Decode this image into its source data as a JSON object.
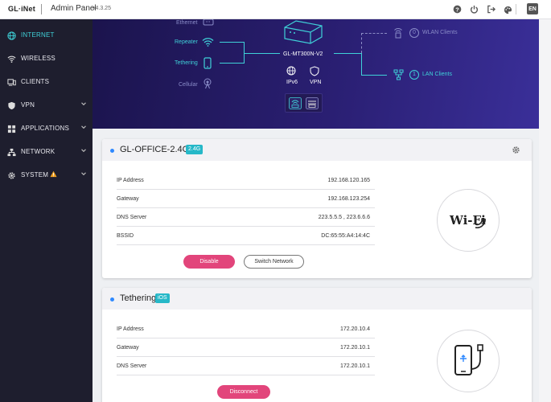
{
  "header": {
    "logo": "GL·iNet",
    "title": "Admin Panel",
    "version": "v4.3.25",
    "language": "EN"
  },
  "sidebar": {
    "items": [
      {
        "label": "INTERNET",
        "icon": "globe-icon",
        "active": true
      },
      {
        "label": "WIRELESS",
        "icon": "wifi-icon"
      },
      {
        "label": "CLIENTS",
        "icon": "clients-icon"
      },
      {
        "label": "VPN",
        "icon": "shield-icon"
      },
      {
        "label": "APPLICATIONS",
        "icon": "apps-icon"
      },
      {
        "label": "NETWORK",
        "icon": "network-icon"
      },
      {
        "label": "SYSTEM",
        "icon": "system-icon",
        "warning": true
      }
    ]
  },
  "topology": {
    "sources": [
      "Ethernet",
      "Repeater",
      "Tethering",
      "Cellular"
    ],
    "router": "GL-MT300N-V2",
    "features": [
      "IPv6",
      "VPN"
    ],
    "wlan": {
      "count": "0",
      "label": "WLAN Clients"
    },
    "lan": {
      "count": "1",
      "label": "LAN Clients"
    }
  },
  "repeater_card": {
    "title": "GL-OFFICE-2.4G",
    "badge": "2.4G",
    "rows": [
      {
        "key": "IP Address",
        "value": "192.168.120.165"
      },
      {
        "key": "Gateway",
        "value": "192.168.123.254"
      },
      {
        "key": "DNS Server",
        "value": "223.5.5.5 , 223.6.6.6"
      },
      {
        "key": "BSSID",
        "value": "DC:65:55:A4:14:4C"
      }
    ],
    "disable_label": "Disable",
    "switch_label": "Switch Network",
    "graphic_text": "Wi-Fi"
  },
  "tethering_card": {
    "title": "Tethering",
    "badge": "iOS",
    "rows": [
      {
        "key": "IP Address",
        "value": "172.20.10.4"
      },
      {
        "key": "Gateway",
        "value": "172.20.10.1"
      },
      {
        "key": "DNS Server",
        "value": "172.20.10.1"
      }
    ],
    "disconnect_label": "Disconnect"
  },
  "colors": {
    "accent": "#3fd1d8",
    "sidebar": "#1e1e2e",
    "pink": "#e2457b",
    "badge": "#26b8c8",
    "hero": "#2a1f73"
  }
}
